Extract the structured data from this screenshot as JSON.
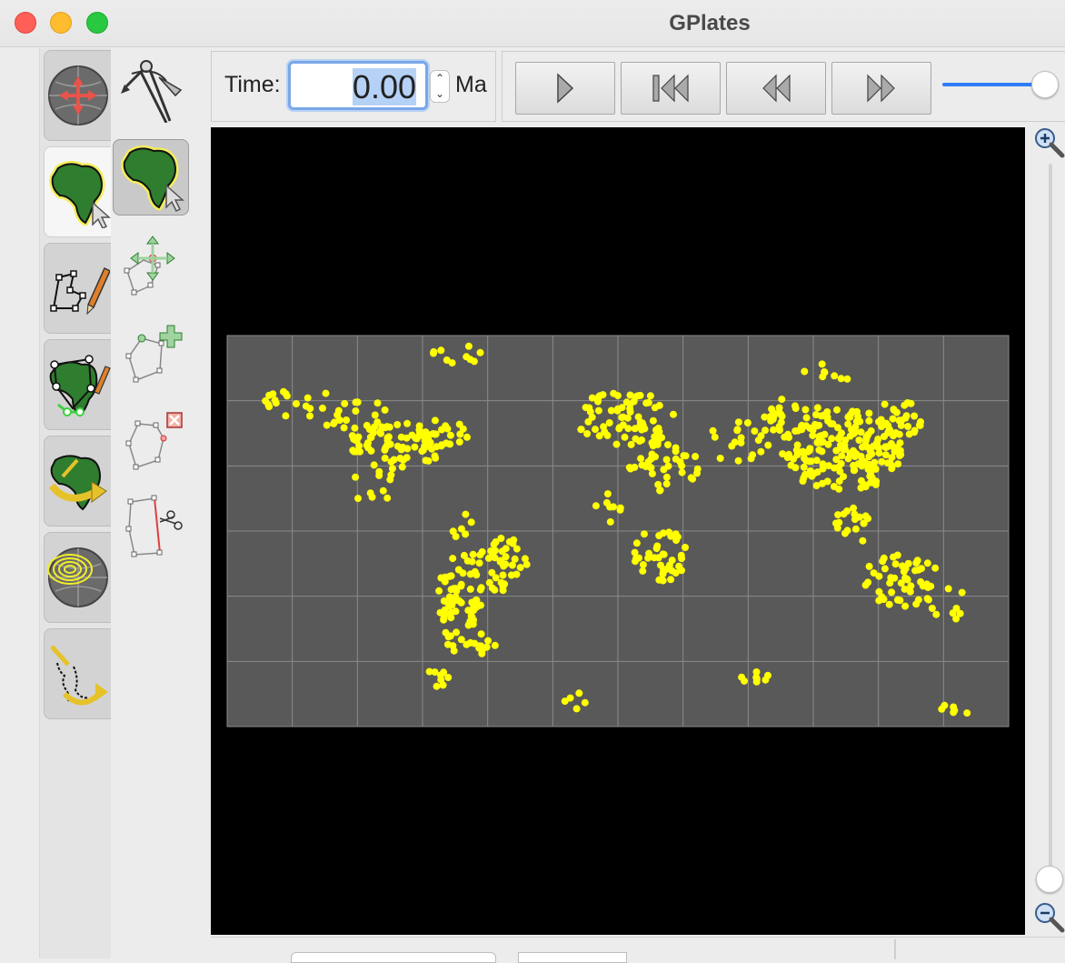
{
  "window": {
    "title": "GPlates"
  },
  "tool_categories": [
    {
      "name": "view",
      "icon": "globe-move-icon",
      "active": false
    },
    {
      "name": "feature-inspection",
      "icon": "africa-select-icon",
      "active": true
    },
    {
      "name": "digitisation",
      "icon": "digitise-pencil-icon",
      "active": false
    },
    {
      "name": "topology",
      "icon": "topology-edit-icon",
      "active": false
    },
    {
      "name": "pole-manipulation",
      "icon": "rotate-plate-icon",
      "active": false
    },
    {
      "name": "small-circle",
      "icon": "small-circle-globe-icon",
      "active": false
    },
    {
      "name": "hellinger",
      "icon": "hellinger-fit-icon",
      "active": false
    }
  ],
  "tools": [
    {
      "name": "measure-distance",
      "icon": "compass-measure-icon",
      "active": false
    },
    {
      "name": "click-geometry",
      "icon": "africa-click-icon",
      "active": true
    },
    {
      "name": "move-vertex",
      "icon": "move-vertex-icon",
      "active": false
    },
    {
      "name": "insert-vertex",
      "icon": "insert-vertex-icon",
      "active": false
    },
    {
      "name": "delete-vertex",
      "icon": "delete-vertex-icon",
      "active": false
    },
    {
      "name": "split-feature",
      "icon": "split-feature-icon",
      "active": false
    }
  ],
  "time": {
    "label": "Time:",
    "value": "0.00",
    "unit": "Ma"
  },
  "animation": {
    "buttons": [
      "play-icon",
      "reset-to-start-icon",
      "step-back-icon",
      "step-forward-icon"
    ],
    "speed_level": 1.0
  },
  "map": {
    "background": "#000000",
    "grid_fill": "#595959",
    "grid_line_color": "#8a8a8a",
    "point_color": "#ffff00",
    "graticule_columns": 12,
    "graticule_rows": 6
  },
  "zoom": {
    "level": 0.0
  },
  "colors": {
    "accent": "#2f7cf6",
    "selection": "#b6d1f6",
    "close": "#fe5f57",
    "minimize": "#febc2e",
    "maximize": "#28c840"
  }
}
